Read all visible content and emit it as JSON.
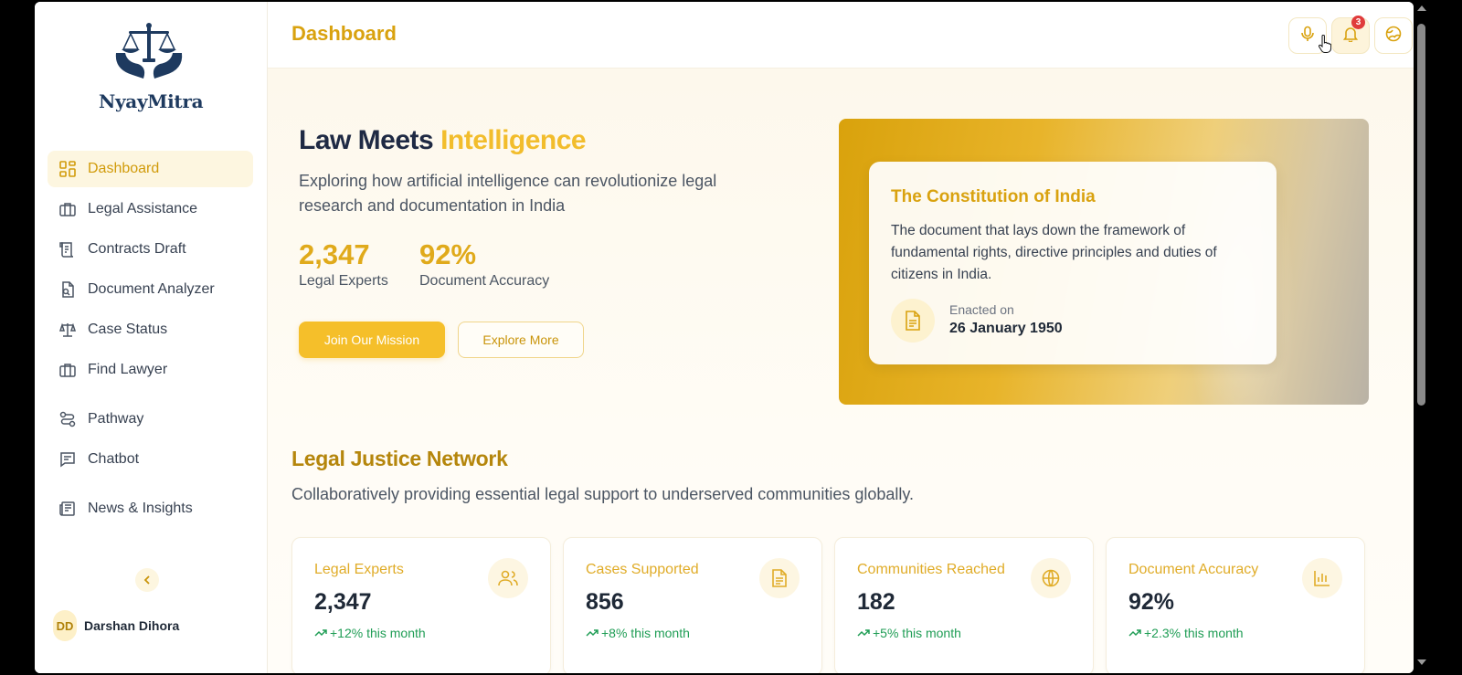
{
  "brand": {
    "name": "NyayMitra"
  },
  "sidebar": {
    "items": [
      {
        "label": "Dashboard",
        "icon": "dashboard-grid-icon"
      },
      {
        "label": "Legal Assistance",
        "icon": "briefcase-icon"
      },
      {
        "label": "Contracts Draft",
        "icon": "scroll-icon"
      },
      {
        "label": "Document Analyzer",
        "icon": "document-search-icon"
      },
      {
        "label": "Case Status",
        "icon": "scales-icon"
      },
      {
        "label": "Find Lawyer",
        "icon": "briefcase-icon"
      },
      {
        "label": "Pathway",
        "icon": "route-icon"
      },
      {
        "label": "Chatbot",
        "icon": "chat-icon"
      },
      {
        "label": "News & Insights",
        "icon": "newspaper-icon"
      }
    ],
    "collapse_icon": "chevron-left-icon",
    "user": {
      "initials": "DD",
      "name": "Darshan Dihora"
    }
  },
  "header": {
    "title": "Dashboard",
    "notification_count": "3",
    "buttons": [
      "microphone-icon",
      "bell-icon",
      "globe-icon"
    ]
  },
  "hero": {
    "title_main": "Law Meets ",
    "title_accent": "Intelligence",
    "subtitle": "Exploring how artificial intelligence can revolutionize legal research and documentation in India",
    "stats": [
      {
        "value": "2,347",
        "label": "Legal Experts"
      },
      {
        "value": "92%",
        "label": "Document Accuracy"
      }
    ],
    "primary_button": "Join Our Mission",
    "secondary_button": "Explore More"
  },
  "constitution_card": {
    "title": "The Constitution of India",
    "description": "The document that lays down the framework of fundamental rights, directive principles and duties of citizens in India.",
    "enacted_label": "Enacted on",
    "enacted_date": "26 January 1950"
  },
  "network": {
    "title": "Legal Justice Network",
    "subtitle": "Collaboratively providing essential legal support to underserved communities globally.",
    "cards": [
      {
        "label": "Legal Experts",
        "value": "2,347",
        "trend": "+12% this month",
        "icon": "users-icon"
      },
      {
        "label": "Cases Supported",
        "value": "856",
        "trend": "+8% this month",
        "icon": "document-icon"
      },
      {
        "label": "Communities Reached",
        "value": "182",
        "trend": "+5% this month",
        "icon": "globe-icon"
      },
      {
        "label": "Document Accuracy",
        "value": "92%",
        "trend": "+2.3% this month",
        "icon": "bar-chart-icon"
      }
    ]
  },
  "colors": {
    "accent": "#f2bd2c",
    "accent_dark": "#d9a20f",
    "trend_green": "#1f9d55",
    "navy": "#1e3a5f"
  }
}
